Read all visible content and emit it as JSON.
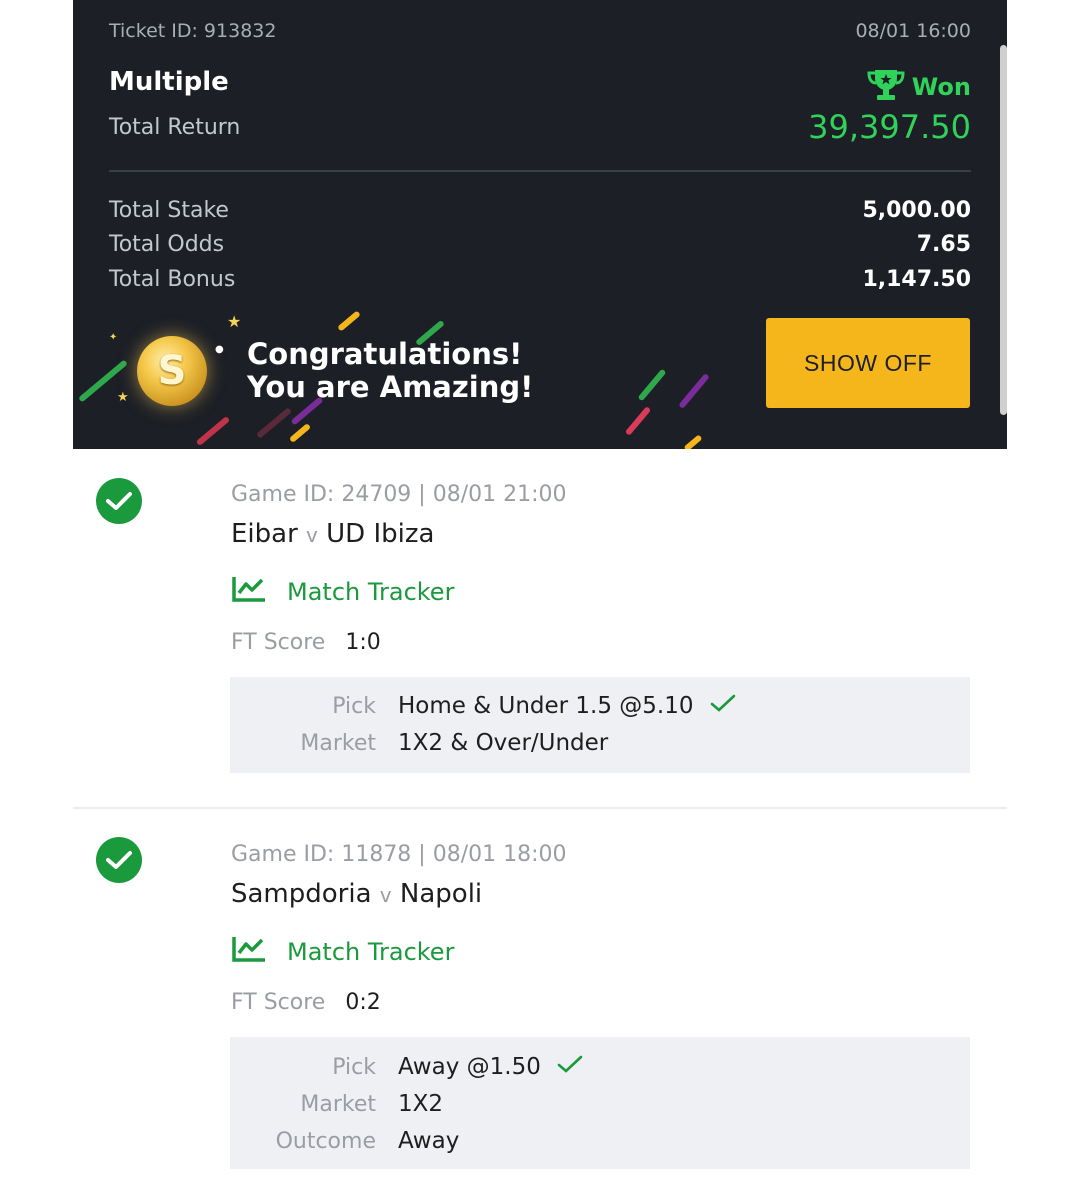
{
  "ticket": {
    "id_label": "Ticket ID: 913832",
    "datetime": "08/01 16:00",
    "type": "Multiple",
    "status": "Won",
    "total_return_label": "Total Return",
    "total_return": "39,397.50",
    "rows": [
      {
        "label": "Total Stake",
        "value": "5,000.00"
      },
      {
        "label": "Total Odds",
        "value": "7.65"
      },
      {
        "label": "Total Bonus",
        "value": "1,147.50"
      }
    ],
    "promo": {
      "line1": "Congratulations!",
      "line2": "You are Amazing!",
      "button_label": "SHOW OFF",
      "coin_symbol": "S"
    }
  },
  "selections": [
    {
      "game_id": "Game ID: 24709 | 08/01 21:00",
      "home": "Eibar",
      "vs": "v",
      "away": "UD Ibiza",
      "tracker_label": "Match Tracker",
      "score_label": "FT Score",
      "score": "1:0",
      "pick_label": "Pick",
      "pick": "Home & Under 1.5 @5.10",
      "market_label": "Market",
      "market": "1X2 & Over/Under"
    },
    {
      "game_id": "Game ID: 11878 | 08/01 18:00",
      "home": "Sampdoria",
      "vs": "v",
      "away": "Napoli",
      "tracker_label": "Match Tracker",
      "score_label": "FT Score",
      "score": "0:2",
      "pick_label": "Pick",
      "pick": "Away @1.50",
      "market_label": "Market",
      "market": "1X2",
      "outcome_label": "Outcome",
      "outcome": "Away"
    }
  ],
  "colors": {
    "header_bg": "#1c1f26",
    "win_green": "#31d25a",
    "check_green": "#1a9a3c",
    "button_yellow": "#f5b61b"
  },
  "icons": [
    "trophy-icon",
    "coin-icon",
    "check-circle-icon",
    "chart-icon",
    "checkmark-icon"
  ]
}
